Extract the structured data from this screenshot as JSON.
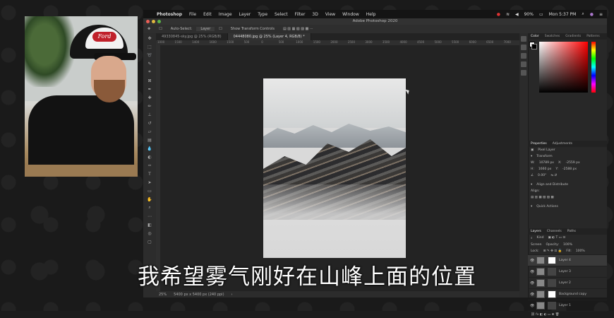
{
  "menubar": {
    "items": [
      "Photoshop",
      "File",
      "Edit",
      "Image",
      "Layer",
      "Type",
      "Select",
      "Filter",
      "3D",
      "View",
      "Window",
      "Help"
    ],
    "battery": "90%",
    "clock": "Mon 5:37 PM"
  },
  "window": {
    "title": "Adobe Photoshop 2020"
  },
  "options_bar": {
    "auto_select_label": "Auto-Select:",
    "auto_select_value": "Layer",
    "show_transform_label": "Show Transform Controls"
  },
  "tabs": [
    {
      "label": "49330845-sky.jpg @ 25% (RGB/8)",
      "active": false
    },
    {
      "label": "04448080.jpg @ 25% (Layer 4, RGB/8) *",
      "active": true
    }
  ],
  "ruler_ticks": [
    "1000",
    "1500",
    "1400",
    "1600",
    "1500",
    "500",
    "0",
    "500",
    "1000",
    "1500",
    "2000",
    "2500",
    "3000",
    "3500",
    "4000",
    "4500",
    "5000",
    "5500",
    "6000",
    "6500",
    "7000"
  ],
  "status": {
    "zoom": "25%",
    "doc_info": "5400 px x 5400 px (240 ppi)"
  },
  "right_panel": {
    "color_tabs": [
      "Color",
      "Swatches",
      "Gradients",
      "Patterns"
    ],
    "properties_tabs": [
      "Properties",
      "Adjustments"
    ],
    "pixel_layer": "Pixel Layer",
    "transform_title": "Transform",
    "w_label": "W:",
    "w_value": "10789 px",
    "x_label": "X:",
    "x_value": "-2559 px",
    "h_label": "H:",
    "h_value": "1660 px",
    "y_label": "Y:",
    "y_value": "-2588 px",
    "angle_value": "0.00°",
    "align_title": "Align and Distribute",
    "align_label": "Align:",
    "quick_actions": "Quick Actions",
    "layers_tabs": [
      "Layers",
      "Channels",
      "Paths"
    ],
    "kind_label": "Kind",
    "blend_mode": "Screen",
    "opacity_label": "Opacity:",
    "opacity_value": "100%",
    "lock_label": "Lock:",
    "fill_label": "Fill:",
    "fill_value": "100%",
    "layers": [
      {
        "name": "Layer 4",
        "selected": true
      },
      {
        "name": "Layer 3",
        "selected": false
      },
      {
        "name": "Layer 2",
        "selected": false
      },
      {
        "name": "Background copy",
        "selected": false
      },
      {
        "name": "Layer 1",
        "selected": false
      }
    ]
  },
  "webcam": {
    "cap_logo": "Ford"
  },
  "subtitle": "我希望雾气刚好在山峰上面的位置"
}
